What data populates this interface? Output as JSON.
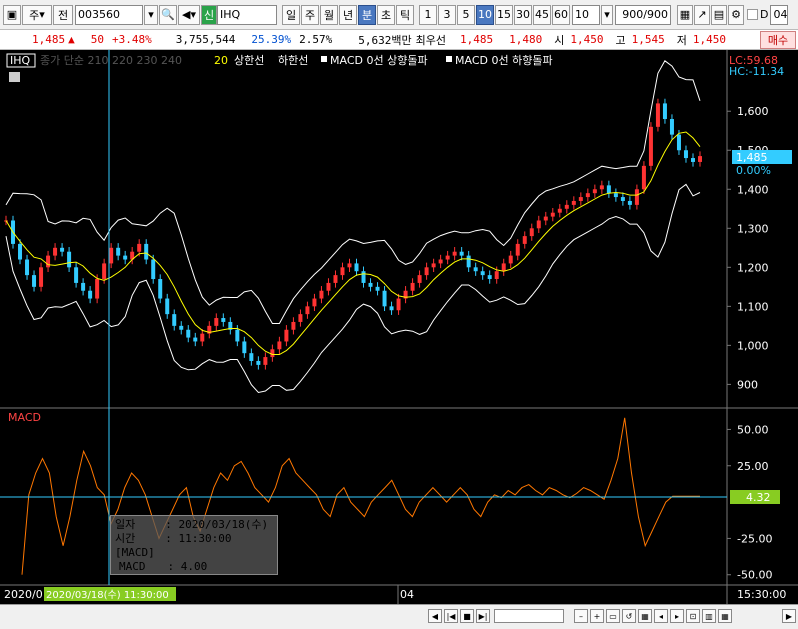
{
  "toolbar": {
    "tab_week": "주",
    "prefix": "전",
    "code": "003560",
    "badge": "신",
    "name": "IHQ",
    "periods": [
      "일",
      "주",
      "월",
      "년",
      "분",
      "초",
      "틱"
    ],
    "selected_period": "분",
    "intervals": [
      "1",
      "3",
      "5",
      "10",
      "15",
      "30",
      "45",
      "60"
    ],
    "selected_interval": "10",
    "interval_select": "10",
    "count": "900",
    "count_total": "/900",
    "checkbox_label": "D",
    "right_text": "04/"
  },
  "info": {
    "price": "1,485",
    "change_arrow": "▲",
    "change": "50",
    "change_pct": "+3.48%",
    "volume": "3,755,544",
    "volume_ratio": "25.39%",
    "turnover": "2.57%",
    "amount": "5,632백만",
    "best_label": "최우선",
    "ask": "1,485",
    "bid": "1,480",
    "open_label": "시",
    "open": "1,450",
    "high_label": "고",
    "high": "1,545",
    "low_label": "저",
    "low": "1,450",
    "buy_button": "매수"
  },
  "legend": {
    "symbol": "IHQ",
    "items_dim": "종가 단순 210  220  230  240",
    "ma20": "20",
    "upper": "상한선",
    "lower": "하한선",
    "macd_up": "MACD 0선 상향돌파",
    "macd_down": "MACD 0선 하향돌파"
  },
  "price_axis": {
    "lc": "LC:59.68",
    "hc": "HC:-11.34",
    "ticks": [
      "1,600",
      "1,500",
      "1,400",
      "1,300",
      "1,200",
      "1,100",
      "1,000",
      "900"
    ],
    "current": "1,485",
    "current_pct": "0.00%"
  },
  "macd_panel": {
    "label": "MACD",
    "ticks": [
      "50.00",
      "25.00",
      "-25.00",
      "-50.00"
    ],
    "current": "4.32"
  },
  "time_axis": {
    "left": "2020/0",
    "cursor": "2020/03/18(수) 11:30:00",
    "mid": "04",
    "right": "15:30:00"
  },
  "tooltip": {
    "date_label": "일자",
    "date_value": ": 2020/03/18(수)",
    "time_label": "시간",
    "time_value": ": 11:30:00",
    "section": "[MACD]",
    "macd_label": "MACD",
    "macd_value": ": 4.00"
  },
  "chart_data": {
    "type": "line",
    "price_ylim": [
      860,
      1680
    ],
    "macd_ylim": [
      -55,
      62
    ],
    "close": [
      1320,
      1260,
      1220,
      1180,
      1150,
      1200,
      1230,
      1250,
      1240,
      1200,
      1160,
      1140,
      1120,
      1170,
      1210,
      1250,
      1230,
      1220,
      1240,
      1260,
      1220,
      1170,
      1120,
      1080,
      1050,
      1040,
      1020,
      1010,
      1030,
      1050,
      1070,
      1060,
      1040,
      1010,
      980,
      960,
      950,
      970,
      990,
      1010,
      1040,
      1060,
      1080,
      1100,
      1120,
      1140,
      1160,
      1180,
      1200,
      1210,
      1190,
      1160,
      1150,
      1140,
      1100,
      1090,
      1120,
      1140,
      1160,
      1180,
      1200,
      1210,
      1220,
      1230,
      1240,
      1230,
      1200,
      1190,
      1180,
      1170,
      1190,
      1210,
      1230,
      1260,
      1280,
      1300,
      1320,
      1330,
      1340,
      1350,
      1360,
      1370,
      1380,
      1390,
      1400,
      1410,
      1390,
      1380,
      1370,
      1360,
      1400,
      1460,
      1560,
      1620,
      1580,
      1540,
      1500,
      1480,
      1470,
      1485
    ],
    "macd": [
      -50,
      5,
      20,
      30,
      20,
      -10,
      -30,
      -10,
      15,
      35,
      25,
      10,
      5,
      -15,
      -5,
      10,
      20,
      15,
      5,
      -10,
      -25,
      -15,
      -5,
      5,
      10,
      -10,
      -20,
      -5,
      10,
      20,
      15,
      25,
      28,
      20,
      10,
      5,
      0,
      10,
      25,
      30,
      20,
      15,
      10,
      5,
      -5,
      -10,
      5,
      10,
      0,
      -5,
      -10,
      0,
      5,
      10,
      15,
      5,
      -5,
      -10,
      0,
      5,
      10,
      5,
      0,
      5,
      10,
      5,
      -5,
      -10,
      0,
      5,
      3,
      8,
      5,
      10,
      12,
      8,
      5,
      10,
      8,
      5,
      3,
      6,
      10,
      8,
      5,
      2,
      15,
      30,
      58,
      20,
      -10,
      -30,
      -20,
      -10,
      0,
      4,
      4,
      4,
      4,
      4
    ]
  }
}
